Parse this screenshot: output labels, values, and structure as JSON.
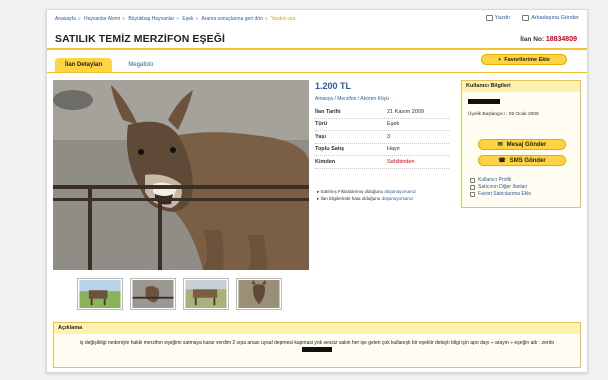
{
  "breadcrumb": {
    "items": [
      "Anasayfa",
      "Hayvanlar Alemi",
      "Büyükbaş Hayvanlar",
      "Eşek",
      "Arama sonuçlarına geri dön",
      "Yardım ara"
    ]
  },
  "topbar": {
    "print": "Yazdır",
    "send_friend": "Arkadaşına Gönder"
  },
  "listing": {
    "title": "SATILIK TEMİZ MERZİFON EŞEĞİ",
    "no_label": "İlan No:",
    "no_value": "18834809"
  },
  "tabs": [
    {
      "label": "İlan Detayları"
    },
    {
      "label": "Megafoto"
    }
  ],
  "favorites_button": "Favorilerime Ekle",
  "price": "1.200 TL",
  "location": "Amasya / Merzifon / Akören Köyü",
  "details": [
    {
      "k": "İlan Tarihi",
      "v": "21 Kasım 2009"
    },
    {
      "k": "Türü",
      "v": "Eşek"
    },
    {
      "k": "Yaşı",
      "v": "3"
    },
    {
      "k": "Toplu Satış",
      "v": "Hayır"
    },
    {
      "k": "Kimden",
      "v": "Sahibinden"
    }
  ],
  "notes": [
    {
      "text": "Satılmış Fiktaslanmış olduğunu",
      "link": "düşünüyorsanız"
    },
    {
      "text": "İlan bilgilerinde hata olduğunu",
      "link": "düşünüyorsanız"
    }
  ],
  "user": {
    "header": "Kullanıcı Bilgileri",
    "since": "Üyelik Başlangıcı : 05 Ocak 2008",
    "message_btn": "Mesaj Gönder",
    "sms_btn": "SMS Gönder",
    "links": [
      "Kullanıcı Profili",
      "Satıcının Diğer İlanları",
      "Favori Satıcılarıma Ekle"
    ]
  },
  "description": {
    "header": "Açıklama",
    "text": "iş değişikligi nedeniyle hakki merzifon eşeğimi satmaya karar verdim 2 sıpa anası uysal depmesi kapmasi yok sessiz sakin her işe gelen çok kullanışlı bir eşektir detaylı bilgi için apo dayı ÷ arayın ÷ eşeğin adı : zerdo"
  },
  "colors": {
    "accent": "#ffd342",
    "link": "#2d5aa0",
    "red": "#d0021b"
  }
}
